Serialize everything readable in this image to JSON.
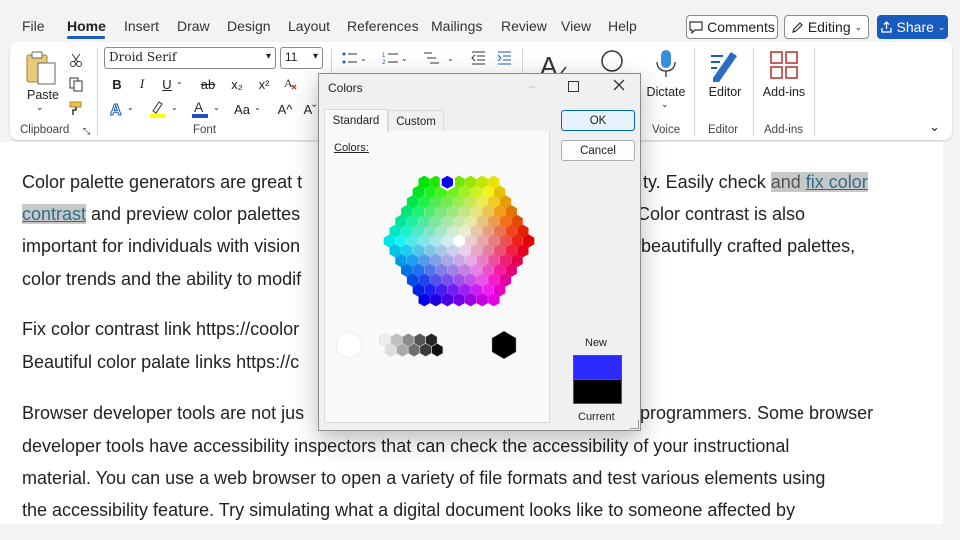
{
  "menu": {
    "tabs": [
      "File",
      "Home",
      "Insert",
      "Draw",
      "Design",
      "Layout",
      "References",
      "Mailings",
      "Review",
      "View",
      "Help"
    ],
    "active": "Home",
    "comments_label": "Comments",
    "editing_label": "Editing",
    "share_label": "Share"
  },
  "ribbon": {
    "font_name": "Droid Serif",
    "font_size": "11",
    "paste_label": "Paste",
    "dictate_label": "Dictate",
    "editor_label": "Editor",
    "addins_label": "Add-ins",
    "groups": {
      "clipboard": "Clipboard",
      "font": "Font",
      "voice": "Voice",
      "editor": "Editor",
      "addins": "Add-ins"
    },
    "font_buttons": {
      "bold": "B",
      "italic": "I",
      "underline": "U",
      "strike": "ab",
      "subscript": "x₂",
      "superscript": "x²",
      "case": "Aa",
      "grow": "A^",
      "shrink": "Aˇ"
    },
    "accent_color": "#185abd"
  },
  "document": {
    "p1": {
      "line1_a": "Color palette generators are great t",
      "line1_b": "ty. Easily check ",
      "line1_c": "and ",
      "line1_link": "fix color",
      "line2_link": "contrast",
      "line2_a": " and preview color palettes",
      "line2_b": "Color contrast is also",
      "line3_a": "important for individuals with vision",
      "line3_b": "beautifully crafted palettes,",
      "line4_a": "color trends and the ability to modif"
    },
    "p2": {
      "line1": "Fix color contrast link https://coolor",
      "line2": "Beautiful color palate links https://c"
    },
    "p3": {
      "line1_a": "Browser developer tools are not jus",
      "line1_b": "programmers. Some browser",
      "line2": "developer tools have accessibility inspectors that can check the accessibility of your instructional",
      "line3": "material. You can use a web browser to open a variety of file formats and test various elements using",
      "line4": "the accessibility feature. Try simulating what a digital document looks like to someone affected by"
    }
  },
  "dialog": {
    "title": "Colors",
    "tabs": [
      "Standard",
      "Custom"
    ],
    "active_tab": "Standard",
    "colors_label": "Colors:",
    "ok_label": "OK",
    "cancel_label": "Cancel",
    "new_label": "New",
    "current_label": "Current",
    "new_color": "#2b2bff",
    "current_color": "#000000",
    "selected_color": "#0000ff",
    "grays": [
      "#ffffff",
      "#eeeeee",
      "#dddddd",
      "#c0c0c0",
      "#a8a8a8",
      "#8c8c8c",
      "#6f6f6f",
      "#555555",
      "#3c3c3c",
      "#262626",
      "#101010",
      "#000000"
    ]
  }
}
